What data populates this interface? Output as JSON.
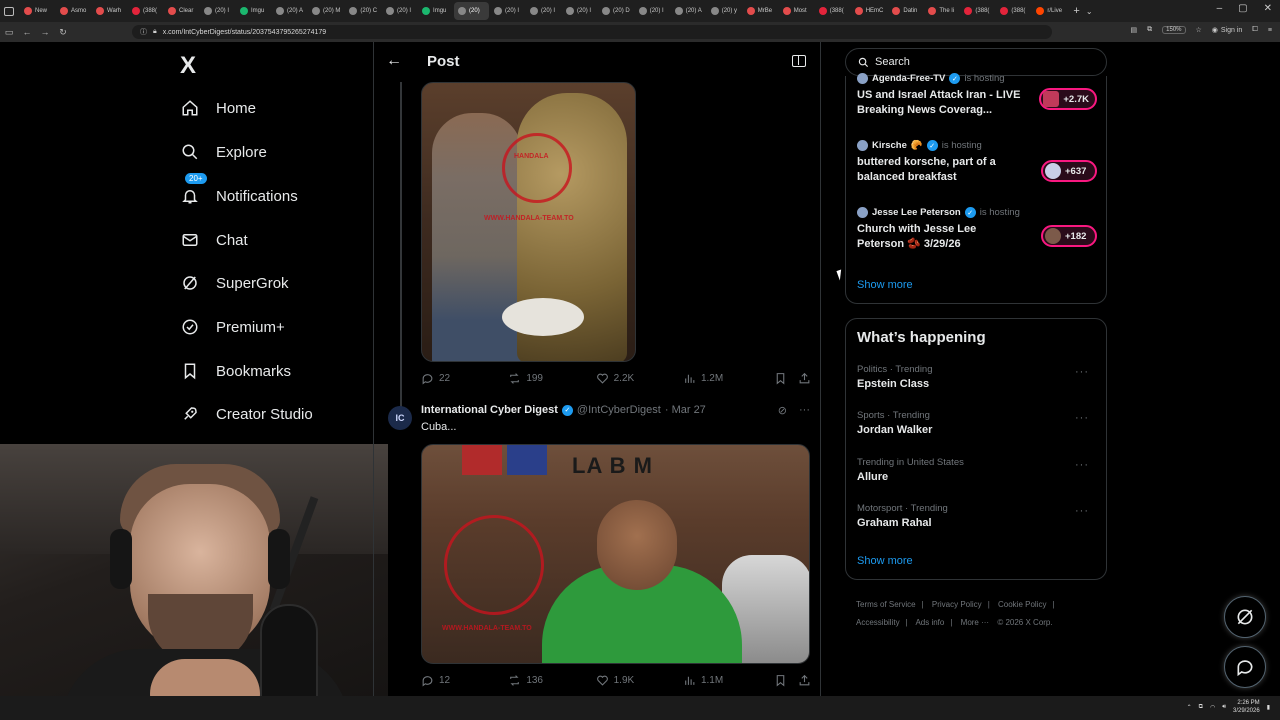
{
  "browser": {
    "tabs": [
      {
        "label": "New",
        "color": "#e34c4c"
      },
      {
        "label": "Asmo",
        "color": "#e34c4c"
      },
      {
        "label": "Warh",
        "color": "#e34c4c"
      },
      {
        "label": "(388(",
        "color": "#e3243b"
      },
      {
        "label": "Clear",
        "color": "#e34c4c"
      },
      {
        "label": "(20) I",
        "color": "#888888"
      },
      {
        "label": "Imgu",
        "color": "#1bb76e"
      },
      {
        "label": "(20) A",
        "color": "#888888"
      },
      {
        "label": "(20) M",
        "color": "#888888"
      },
      {
        "label": "(20) C",
        "color": "#888888"
      },
      {
        "label": "(20) I",
        "color": "#888888"
      },
      {
        "label": "Imgu",
        "color": "#1bb76e"
      },
      {
        "label": "(20)",
        "color": "#888888",
        "active": true
      },
      {
        "label": "(20) I",
        "color": "#888888"
      },
      {
        "label": "(20) I",
        "color": "#888888"
      },
      {
        "label": "(20) I",
        "color": "#888888"
      },
      {
        "label": "(20) D",
        "color": "#888888"
      },
      {
        "label": "(20) I",
        "color": "#888888"
      },
      {
        "label": "(20) A",
        "color": "#888888"
      },
      {
        "label": "(20) y",
        "color": "#888888"
      },
      {
        "label": "MrBe",
        "color": "#e34c4c"
      },
      {
        "label": "Most",
        "color": "#e34c4c"
      },
      {
        "label": "(388(",
        "color": "#e3243b"
      },
      {
        "label": "HEmC",
        "color": "#e34c4c"
      },
      {
        "label": "Datin",
        "color": "#e34c4c"
      },
      {
        "label": "The li",
        "color": "#e34c4c"
      },
      {
        "label": "(388(",
        "color": "#e3243b"
      },
      {
        "label": "(388(",
        "color": "#e3243b"
      },
      {
        "label": "r/Live",
        "color": "#ff4500"
      }
    ],
    "url": "x.com/IntCyberDigest/status/2037543795265274179",
    "zoom": "150%",
    "signin": "Sign in"
  },
  "nav": {
    "logo": "X",
    "items": [
      {
        "label": "Home",
        "icon": "home-icon"
      },
      {
        "label": "Explore",
        "icon": "search-icon"
      },
      {
        "label": "Notifications",
        "icon": "bell-icon",
        "badge": "20+"
      },
      {
        "label": "Chat",
        "icon": "mail-icon"
      },
      {
        "label": "SuperGrok",
        "icon": "grok-icon"
      },
      {
        "label": "Premium+",
        "icon": "verified-icon"
      },
      {
        "label": "Bookmarks",
        "icon": "bookmark-icon"
      },
      {
        "label": "Creator Studio",
        "icon": "rocket-icon"
      }
    ]
  },
  "post": {
    "title": "Post",
    "tweet1": {
      "stamp": "HANDALA",
      "stamp_url": "WWW.HANDALA-TEAM.TO",
      "replies": "22",
      "reposts": "199",
      "likes": "2.2K",
      "views": "1.2M"
    },
    "tweet2": {
      "avatar": "IC",
      "name": "International Cyber Digest",
      "handle": "@IntCyberDigest",
      "date": "· Mar 27",
      "text": "Cuba...",
      "sign": "LA B  M",
      "stamp_url": "WWW.HANDALA-TEAM.TO",
      "replies": "12",
      "reposts": "136",
      "likes": "1.9K",
      "views": "1.1M"
    }
  },
  "sidebar": {
    "search_placeholder": "Search",
    "spaces": [
      {
        "host": "Agenda-Free-TV",
        "hosting": "is hosting",
        "title": "US and Israel Attack Iran - LIVE Breaking News Coverag...",
        "count": "+2.7K"
      },
      {
        "host": "Kirsche",
        "hosting": "is hosting",
        "title": "buttered korsche, part of a balanced breakfast",
        "count": "+637"
      },
      {
        "host": "Jesse Lee Peterson",
        "hosting": "is hosting",
        "title": "Church with Jesse Lee Peterson 🫘 3/29/26",
        "count": "+182"
      }
    ],
    "spaces_show_more": "Show more",
    "happening": {
      "title": "What’s happening",
      "trends": [
        {
          "meta": "Politics · Trending",
          "name": "Epstein Class"
        },
        {
          "meta": "Sports · Trending",
          "name": "Jordan Walker"
        },
        {
          "meta": "Trending in United States",
          "name": "Allure"
        },
        {
          "meta": "Motorsport · Trending",
          "name": "Graham Rahal"
        }
      ],
      "show_more": "Show more"
    },
    "footer": [
      "Terms of Service",
      "|",
      "Privacy Policy",
      "|",
      "Cookie Policy",
      "|",
      "Accessibility",
      "|",
      "Ads info",
      "|",
      "More ···",
      "© 2026 X Corp."
    ]
  },
  "taskbar": {
    "time": "2:26 PM",
    "date": "3/29/2026"
  },
  "colors": {
    "accent": "#1d9bf0",
    "live_pink": "#f91880",
    "border": "#2f3336",
    "muted": "#71767b"
  }
}
